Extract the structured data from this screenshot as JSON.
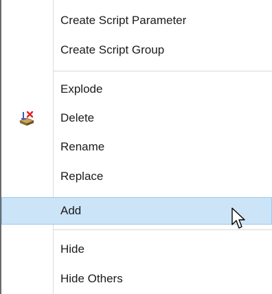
{
  "menu": {
    "items": [
      {
        "label": "Create Script Parameter"
      },
      {
        "label": "Create Script Group"
      },
      {
        "label": "Explode"
      },
      {
        "label": "Delete",
        "icon": "delete-icon"
      },
      {
        "label": "Rename"
      },
      {
        "label": "Replace"
      },
      {
        "label": "Add",
        "highlighted": true
      },
      {
        "label": "Hide"
      },
      {
        "label": "Hide Others"
      }
    ]
  },
  "colors": {
    "highlight_bg": "#cce4f7",
    "highlight_border": "#99c9ef",
    "text": "#1a1a1a",
    "separator": "#d7d7d7"
  },
  "cursor": {
    "icon": "mouse-pointer-icon"
  }
}
